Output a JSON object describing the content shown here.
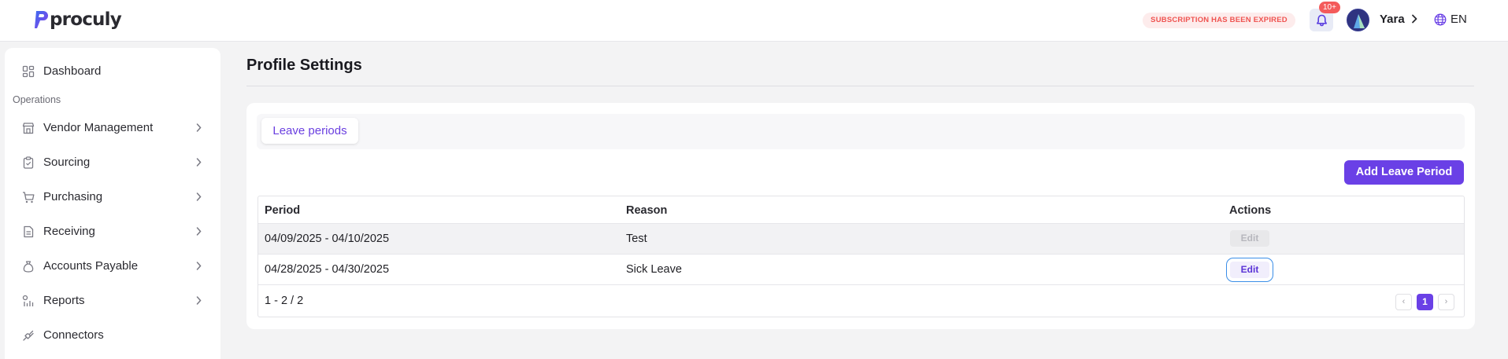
{
  "header": {
    "brand": "proculy",
    "subscription_notice": "SUBSCRIPTION HAS BEEN EXPIRED",
    "notification_count": "10+",
    "user_name": "Yara",
    "language": "EN",
    "accent_color": "#6a40e6",
    "alert_color": "#ef5350"
  },
  "sidebar": {
    "top_item": {
      "label": "Dashboard",
      "icon": "dashboard-icon"
    },
    "section_label": "Operations",
    "items": [
      {
        "label": "Vendor Management",
        "icon": "store-icon"
      },
      {
        "label": "Sourcing",
        "icon": "clipboard-icon"
      },
      {
        "label": "Purchasing",
        "icon": "cart-icon"
      },
      {
        "label": "Receiving",
        "icon": "document-icon"
      },
      {
        "label": "Accounts Payable",
        "icon": "money-bag-icon"
      },
      {
        "label": "Reports",
        "icon": "reports-icon"
      },
      {
        "label": "Connectors",
        "icon": "plug-icon"
      }
    ]
  },
  "main": {
    "title": "Profile Settings",
    "tabs": [
      {
        "label": "Leave periods",
        "active": true
      }
    ],
    "add_button": "Add Leave Period",
    "table": {
      "columns": [
        "Period",
        "Reason",
        "Actions"
      ],
      "rows": [
        {
          "period": "04/09/2025 - 04/10/2025",
          "reason": "Test",
          "action": "Edit",
          "enabled": false
        },
        {
          "period": "04/28/2025 - 04/30/2025",
          "reason": "Sick Leave",
          "action": "Edit",
          "enabled": true
        }
      ],
      "pagination": {
        "summary": "1 - 2 / 2",
        "current_page": "1",
        "prev": "‹",
        "next": "›"
      }
    }
  }
}
